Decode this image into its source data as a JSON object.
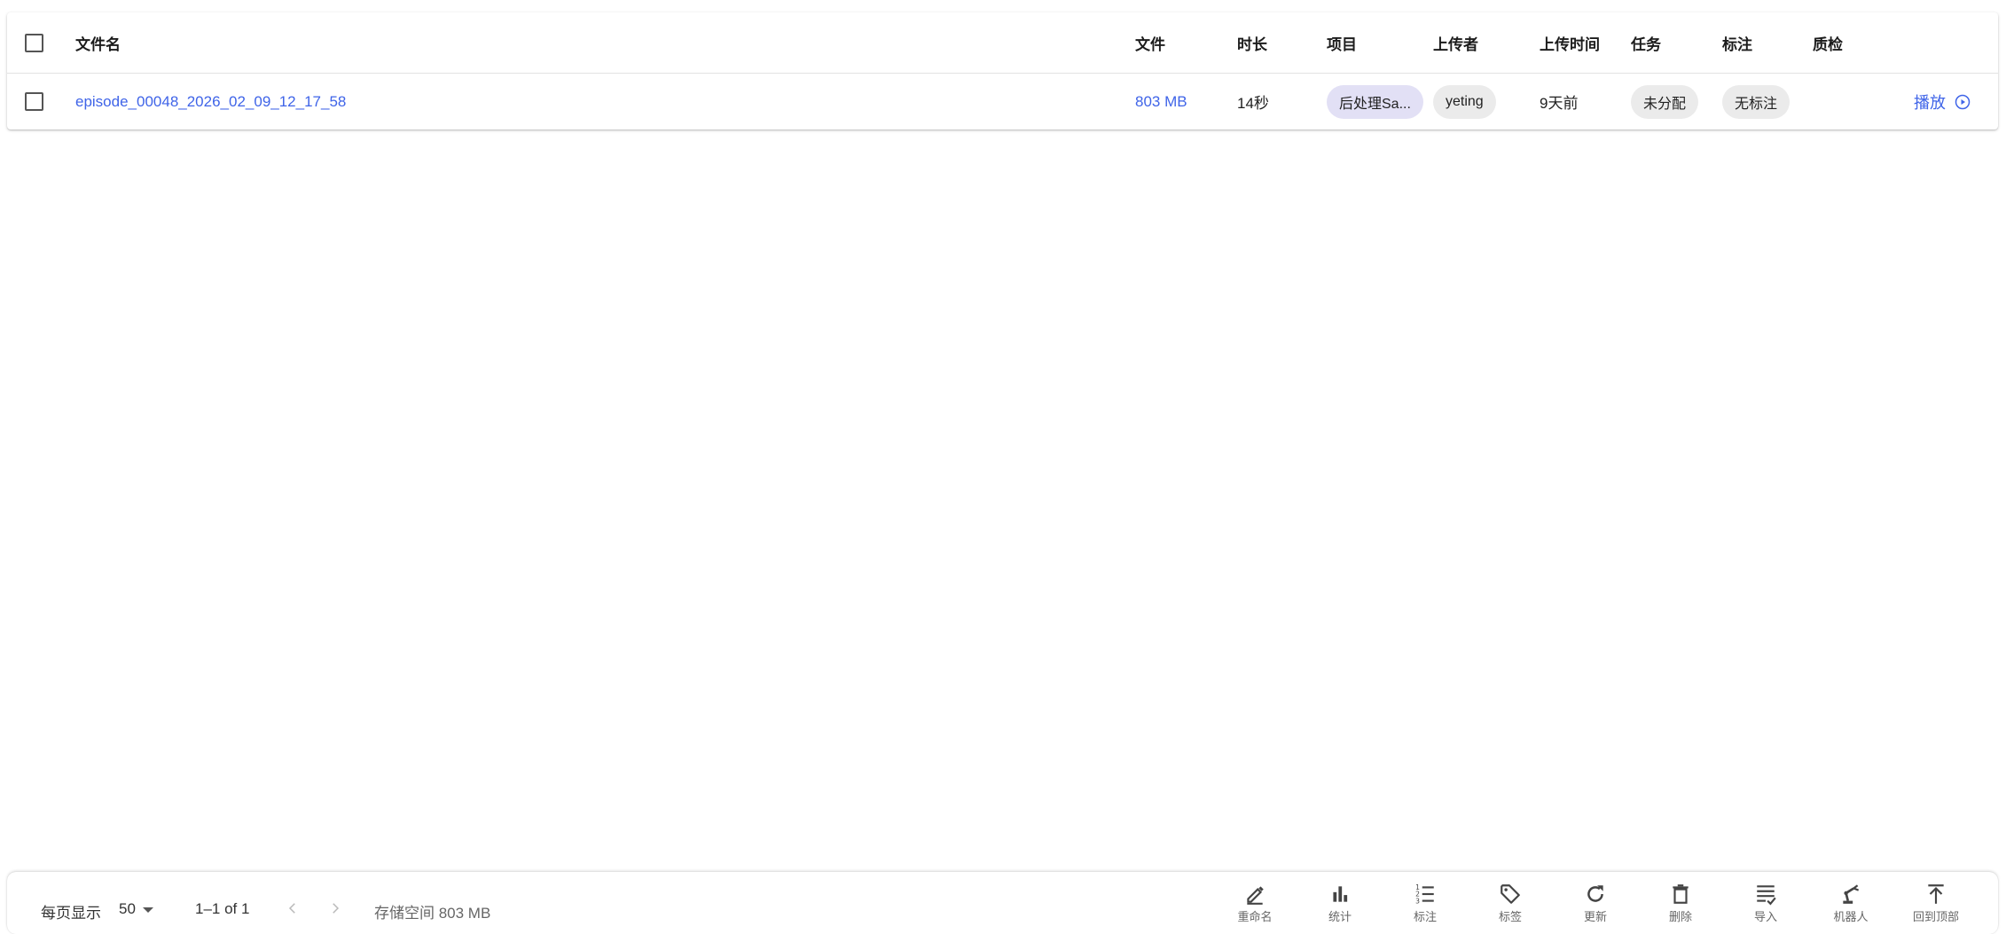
{
  "table": {
    "headers": {
      "filename": "文件名",
      "file": "文件",
      "duration": "时长",
      "project": "项目",
      "uploader": "上传者",
      "upload_time": "上传时间",
      "task": "任务",
      "annotation": "标注",
      "qc": "质检"
    },
    "rows": [
      {
        "filename": "episode_00048_2026_02_09_12_17_58",
        "file": "803 MB",
        "duration": "14秒",
        "project": "后处理Sa...",
        "uploader": "yeting",
        "upload_time": "9天前",
        "task": "未分配",
        "annotation": "无标注",
        "qc": "",
        "action": "播放"
      }
    ]
  },
  "footer": {
    "rows_per_page_label": "每页显示",
    "rows_per_page_value": "50",
    "range": "1–1 of 1",
    "storage": "存储空间 803 MB",
    "tools": {
      "rename": "重命名",
      "stats": "统计",
      "annotate": "标注",
      "tag": "标签",
      "refresh": "更新",
      "delete": "删除",
      "import": "导入",
      "robot": "机器人",
      "to_top": "回到顶部"
    }
  },
  "colors": {
    "link": "#3f64e8",
    "chip": "#ebebeb",
    "project_chip": "#e2e0f5"
  },
  "icons": [
    "edit-icon",
    "bar-chart-icon",
    "list-numbered-icon",
    "tag-icon",
    "refresh-icon",
    "trash-icon",
    "import-list-icon",
    "robot-arm-icon",
    "arrow-to-top-icon",
    "play-circle-icon",
    "chevron-left-icon",
    "chevron-right-icon",
    "dropdown-caret-icon"
  ]
}
